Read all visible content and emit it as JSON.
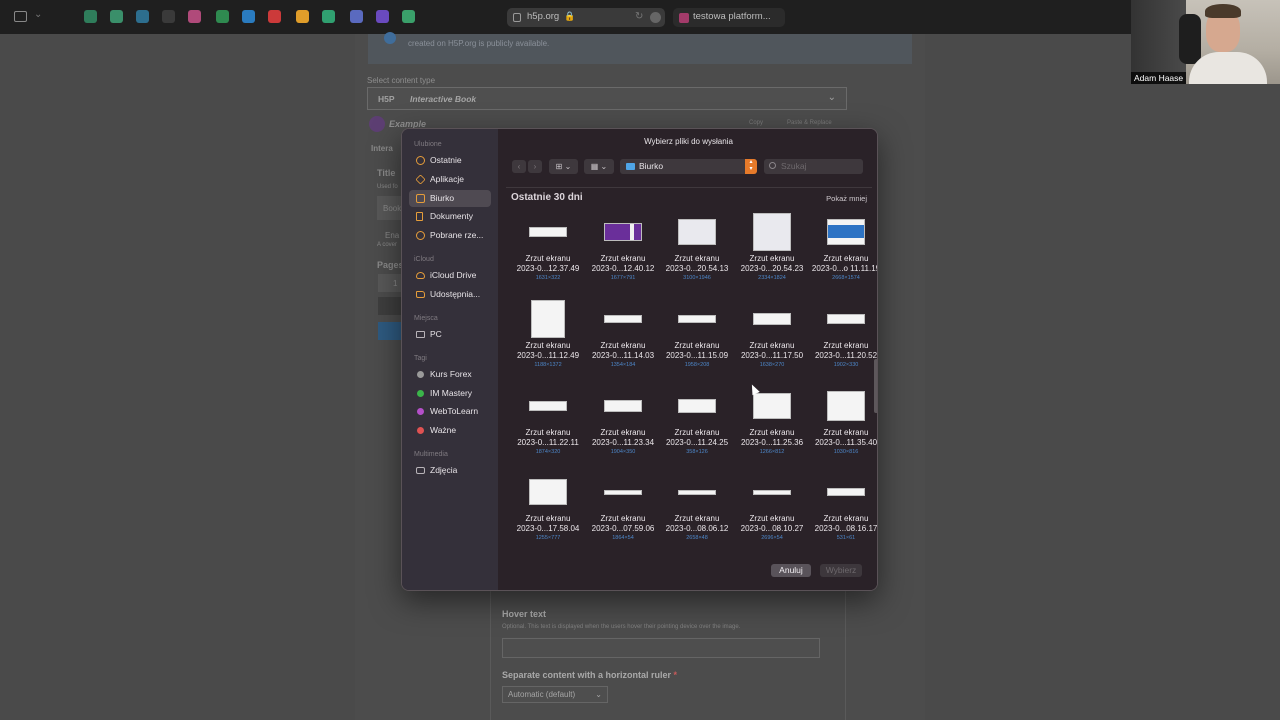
{
  "browser": {
    "address": "h5p.org",
    "tab2_title": "testowa platform...",
    "extension_colors": [
      "#2f7d5b",
      "#3a8f6a",
      "#2d6e8e",
      "#3a3a3a",
      "#b04a7a",
      "#2f8a50",
      "#2a7bbf",
      "#cc3a3a",
      "#e09d2a",
      "#30a070",
      "#5a6abf",
      "#6a4abf",
      "#3aa06a"
    ]
  },
  "webcam": {
    "name": "Adam Haase"
  },
  "background_page": {
    "notice_text": "created on H5P.org is publicly available.",
    "select_label": "Select content type",
    "content_type_logo": "H5P",
    "content_type": "Interactive Book",
    "example_title": "Example",
    "copy_label": "Copy",
    "paste_label": "Paste & Replace",
    "side_texts": [
      "Intera",
      "Title",
      "Used fo",
      "Book",
      "Ena",
      "A cover",
      "Pages",
      "1"
    ],
    "hover_text_title": "Hover text",
    "hover_text_desc": "Optional. This text is displayed when the users hover their pointing device over the image.",
    "ruler_title": "Separate content with a horizontal ruler",
    "ruler_required": "*",
    "ruler_value": "Automatic (default)"
  },
  "dialog": {
    "title": "Wybierz pliki do wysłania",
    "location": "Biurko",
    "search_placeholder": "Szukaj",
    "group_title": "Ostatnie 30 dni",
    "show_less": "Pokaż mniej",
    "cancel_label": "Anuluj",
    "open_label": "Wybierz",
    "sidebar": {
      "favorites_header": "Ulubione",
      "favorites": [
        {
          "label": "Ostatnie",
          "icon": "clock-icon"
        },
        {
          "label": "Aplikacje",
          "icon": "apps-icon"
        },
        {
          "label": "Biurko",
          "icon": "desktop-icon",
          "active": true
        },
        {
          "label": "Dokumenty",
          "icon": "document-icon"
        },
        {
          "label": "Pobrane rze...",
          "icon": "downloads-icon"
        }
      ],
      "icloud_header": "iCloud",
      "icloud": [
        {
          "label": "iCloud Drive",
          "icon": "cloud-icon"
        },
        {
          "label": "Udostępnia...",
          "icon": "shared-folder-icon"
        }
      ],
      "places_header": "Miejsca",
      "places": [
        {
          "label": "PC",
          "icon": "computer-icon"
        }
      ],
      "tags_header": "Tagi",
      "tags": [
        {
          "label": "Kurs Forex",
          "color": "#9a9a9a"
        },
        {
          "label": "IM Mastery",
          "color": "#3bb54a"
        },
        {
          "label": "WebToLearn",
          "color": "#b44fc9"
        },
        {
          "label": "Ważne",
          "color": "#e05252"
        }
      ],
      "media_header": "Multimedia",
      "media": [
        {
          "label": "Zdjęcia",
          "icon": "photos-icon"
        }
      ]
    },
    "files": [
      {
        "name": "Zrzut ekranu",
        "date": "2023-0...12.37.49",
        "dims": "1631×322"
      },
      {
        "name": "Zrzut ekranu",
        "date": "2023-0...12.40.12",
        "dims": "1677×791"
      },
      {
        "name": "Zrzut ekranu",
        "date": "2023-0...20.54.13",
        "dims": "3100×1946"
      },
      {
        "name": "Zrzut ekranu",
        "date": "2023-0...20.54.23",
        "dims": "2334×1824"
      },
      {
        "name": "Zrzut ekranu",
        "date": "2023-0...o 11.11.19",
        "dims": "2668×1574"
      },
      {
        "name": "Zrzut ekranu",
        "date": "2023-0...11.12.49",
        "dims": "1188×1372"
      },
      {
        "name": "Zrzut ekranu",
        "date": "2023-0...11.14.03",
        "dims": "1354×184"
      },
      {
        "name": "Zrzut ekranu",
        "date": "2023-0...11.15.09",
        "dims": "1958×208"
      },
      {
        "name": "Zrzut ekranu",
        "date": "2023-0...11.17.50",
        "dims": "1638×270"
      },
      {
        "name": "Zrzut ekranu",
        "date": "2023-0...11.20.52",
        "dims": "1902×330"
      },
      {
        "name": "Zrzut ekranu",
        "date": "2023-0...11.22.11",
        "dims": "1874×320"
      },
      {
        "name": "Zrzut ekranu",
        "date": "2023-0...11.23.34",
        "dims": "1904×350"
      },
      {
        "name": "Zrzut ekranu",
        "date": "2023-0...11.24.25",
        "dims": "358×126"
      },
      {
        "name": "Zrzut ekranu",
        "date": "2023-0...11.25.36",
        "dims": "1266×812"
      },
      {
        "name": "Zrzut ekranu",
        "date": "2023-0...11.35.40",
        "dims": "1030×816"
      },
      {
        "name": "Zrzut ekranu",
        "date": "2023-0...17.58.04",
        "dims": "1255×777"
      },
      {
        "name": "Zrzut ekranu",
        "date": "2023-0...07.59.06",
        "dims": "1864×54"
      },
      {
        "name": "Zrzut ekranu",
        "date": "2023-0...08.06.12",
        "dims": "2658×48"
      },
      {
        "name": "Zrzut ekranu",
        "date": "2023-0...08.10.27",
        "dims": "2696×54"
      },
      {
        "name": "Zrzut ekranu",
        "date": "2023-0...08.16.17",
        "dims": "531×61"
      }
    ]
  }
}
